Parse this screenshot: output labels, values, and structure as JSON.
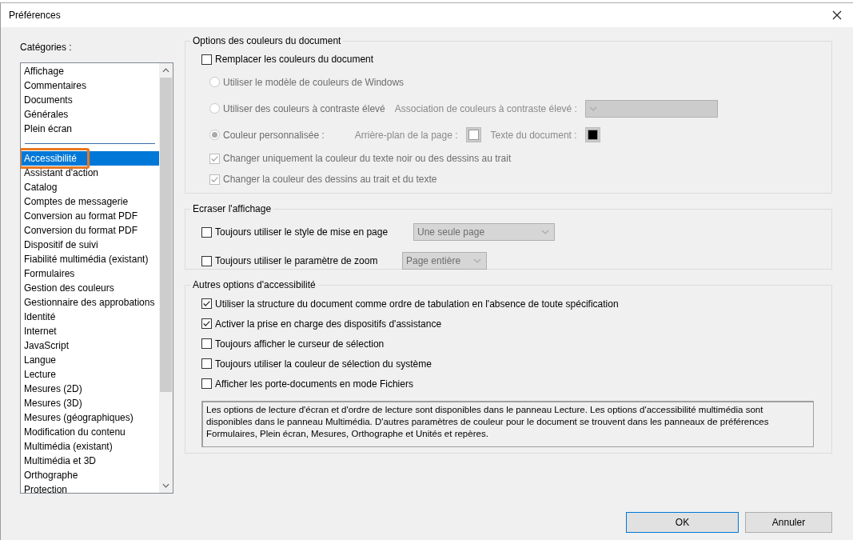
{
  "window": {
    "title": "Préférences"
  },
  "categories": {
    "label": "Catégories :",
    "pinned": [
      {
        "label": "Affichage",
        "selected": false,
        "highlighted": false
      },
      {
        "label": "Commentaires",
        "selected": false,
        "highlighted": false
      },
      {
        "label": "Documents",
        "selected": false,
        "highlighted": false
      },
      {
        "label": "Générales",
        "selected": false,
        "highlighted": false
      },
      {
        "label": "Plein écran",
        "selected": false,
        "highlighted": false
      }
    ],
    "items": [
      {
        "label": "Accessibilité",
        "selected": true,
        "highlighted": true
      },
      {
        "label": "Assistant d'action",
        "selected": false,
        "highlighted": false
      },
      {
        "label": "Catalog",
        "selected": false,
        "highlighted": false
      },
      {
        "label": "Comptes de messagerie",
        "selected": false,
        "highlighted": false
      },
      {
        "label": "Conversion au format PDF",
        "selected": false,
        "highlighted": false
      },
      {
        "label": "Conversion du format PDF",
        "selected": false,
        "highlighted": false
      },
      {
        "label": "Dispositif de suivi",
        "selected": false,
        "highlighted": false
      },
      {
        "label": "Fiabilité multimédia (existant)",
        "selected": false,
        "highlighted": false
      },
      {
        "label": "Formulaires",
        "selected": false,
        "highlighted": false
      },
      {
        "label": "Gestion des couleurs",
        "selected": false,
        "highlighted": false
      },
      {
        "label": "Gestionnaire des approbations",
        "selected": false,
        "highlighted": false
      },
      {
        "label": "Identité",
        "selected": false,
        "highlighted": false
      },
      {
        "label": "Internet",
        "selected": false,
        "highlighted": false
      },
      {
        "label": "JavaScript",
        "selected": false,
        "highlighted": false
      },
      {
        "label": "Langue",
        "selected": false,
        "highlighted": false
      },
      {
        "label": "Lecture",
        "selected": false,
        "highlighted": false
      },
      {
        "label": "Mesures (2D)",
        "selected": false,
        "highlighted": false
      },
      {
        "label": "Mesures (3D)",
        "selected": false,
        "highlighted": false
      },
      {
        "label": "Mesures (géographiques)",
        "selected": false,
        "highlighted": false
      },
      {
        "label": "Modification du contenu",
        "selected": false,
        "highlighted": false
      },
      {
        "label": "Multimédia (existant)",
        "selected": false,
        "highlighted": false
      },
      {
        "label": "Multimédia et 3D",
        "selected": false,
        "highlighted": false
      },
      {
        "label": "Orthographe",
        "selected": false,
        "highlighted": false
      },
      {
        "label": "Protection",
        "selected": false,
        "highlighted": false
      }
    ]
  },
  "color_options": {
    "title": "Options des couleurs du document",
    "replace": {
      "label": "Remplacer les couleurs du document",
      "checked": false
    },
    "radios": [
      {
        "kind": "plain",
        "label": "Utiliser le modèle de couleurs de Windows",
        "selected": false,
        "disabled": true
      },
      {
        "kind": "dropdown",
        "label": "Utiliser des couleurs à contraste élevé",
        "selected": false,
        "disabled": true,
        "field_label": "Association de couleurs à contraste élevé :"
      },
      {
        "kind": "swatches",
        "label": "Couleur personnalisée :",
        "selected": true,
        "disabled": true,
        "swatches": [
          {
            "label": "Arrière-plan de la page :",
            "color": "#ffffff"
          },
          {
            "label": "Texte du document :",
            "color": "#000000"
          }
        ]
      }
    ],
    "checks": [
      {
        "label": "Changer uniquement la couleur du texte noir ou des dessins au trait",
        "checked": true,
        "disabled": true
      },
      {
        "label": "Changer la couleur des dessins au trait et du texte",
        "checked": true,
        "disabled": true
      }
    ]
  },
  "override_view": {
    "title": "Ecraser l'affichage",
    "rows": [
      {
        "label": "Toujours utiliser le style de mise en page",
        "checked": false,
        "value": "Une seule page",
        "disabled": true
      },
      {
        "label": "Toujours utiliser le paramètre de zoom",
        "checked": false,
        "value": "Page entière",
        "disabled": true
      }
    ]
  },
  "other_options": {
    "title": "Autres options d'accessibilité",
    "checks": [
      {
        "label": "Utiliser la structure du document comme ordre de tabulation en l'absence de toute spécification",
        "checked": true
      },
      {
        "label": "Activer la prise en charge des dispositifs d'assistance",
        "checked": true
      },
      {
        "label": "Toujours afficher le curseur de sélection",
        "checked": false
      },
      {
        "label": "Toujours utiliser la couleur de sélection du système",
        "checked": false
      },
      {
        "label": "Afficher les porte-documents en mode Fichiers",
        "checked": false
      }
    ],
    "note": "Les options de lecture d'écran et d'ordre de lecture sont disponibles dans le panneau Lecture. Les options d'accessibilité multimédia sont disponibles dans le panneau Multimédia. D'autres paramètres de couleur pour le document se trouvent dans les panneaux de préférences Formulaires, Plein écran, Mesures, Orthographe et Unités et repères."
  },
  "buttons": [
    {
      "label": "OK"
    },
    {
      "label": "Annuler"
    }
  ]
}
